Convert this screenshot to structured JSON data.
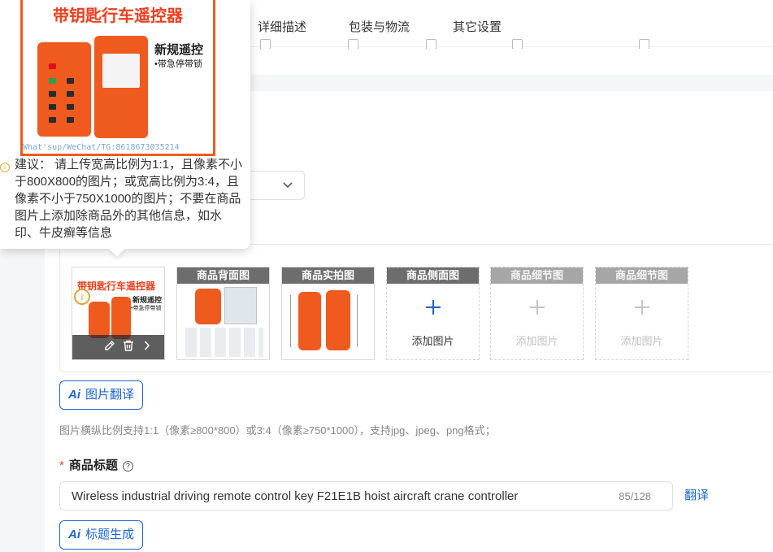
{
  "tabs": [
    {
      "label": "详细描述"
    },
    {
      "label": "包装与物流"
    },
    {
      "label": "其它设置"
    }
  ],
  "tooltip": {
    "banner": "带钥匙行车遥控器",
    "side_title": "新规遥控",
    "side_sub": "•带急停带锁",
    "watermark": "What'sup/WeChat/TG:8618673035214",
    "suggestion": "建议： 请上传宽高比例为1:1，且像素不小于800X800的图片；或宽高比例为3:4，且像素不小于750X1000的图片；不要在商品图片上添加除商品外的其他信息，如水印、牛皮癣等信息"
  },
  "image_slots": [
    {
      "caption": "",
      "type": "main"
    },
    {
      "caption": "商品背面图",
      "type": "photo"
    },
    {
      "caption": "商品实拍图",
      "type": "photo"
    },
    {
      "caption": "商品侧面图",
      "type": "add",
      "add_label": "添加图片"
    },
    {
      "caption": "商品细节图",
      "type": "add-disabled",
      "add_label": "添加图片"
    },
    {
      "caption": "商品细节图",
      "type": "add-disabled",
      "add_label": "添加图片"
    }
  ],
  "main_thumb": {
    "banner": "带钥匙行车遥控器",
    "side": "新规遥控",
    "side_sub": "•带急停带锁"
  },
  "buttons": {
    "image_translate": "图片翻译",
    "title_generate": "标题生成",
    "ai_mark": "Ai"
  },
  "hint": "图片横纵比例支持1:1（像素≥800*800）或3:4（像素≥750*1000），支持jpg、jpeg、png格式；",
  "title_field": {
    "label": "商品标题",
    "value": "Wireless industrial driving remote control key F21E1B hoist aircraft crane controller",
    "count": "85/128",
    "translate": "翻译"
  },
  "colors": {
    "accent": "#1a66d6",
    "remote_orange": "#ef5a1f",
    "required": "#e5472b"
  }
}
